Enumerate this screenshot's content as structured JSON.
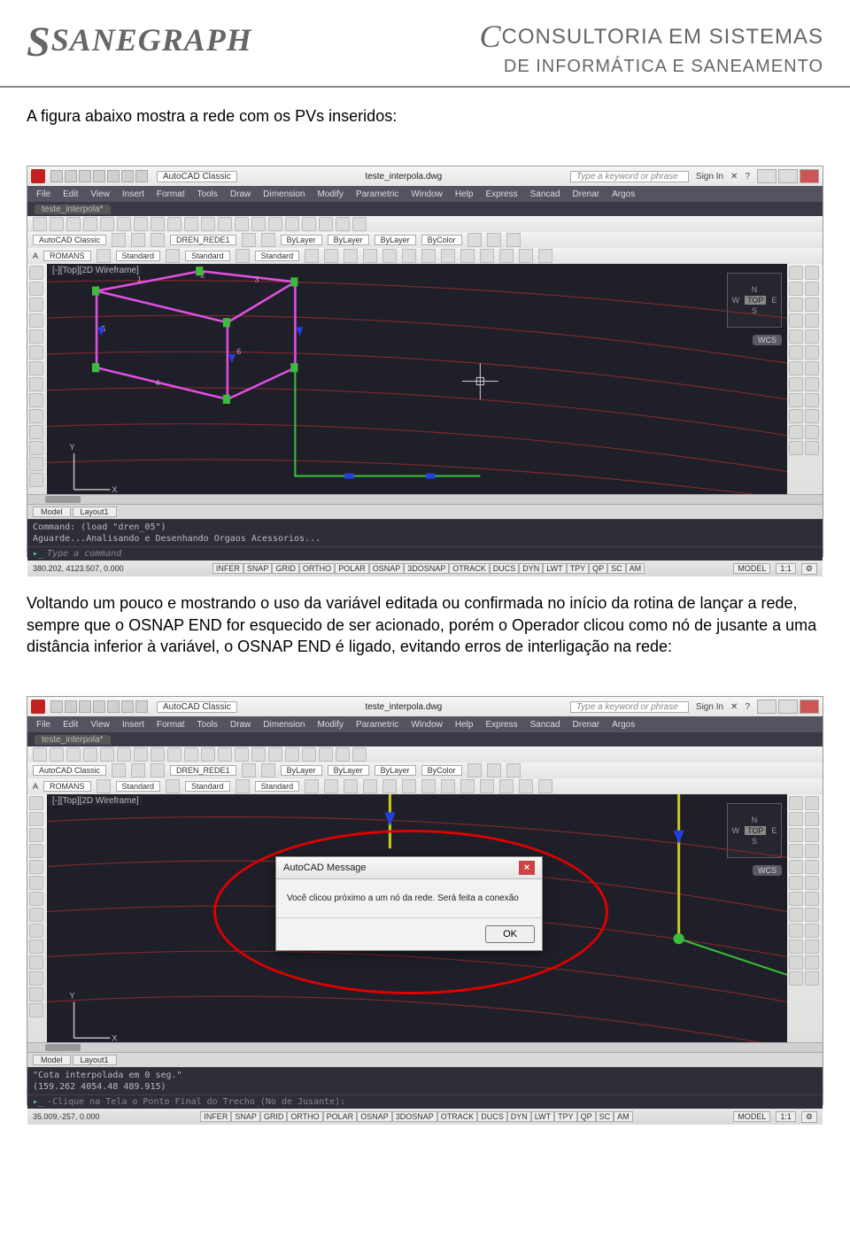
{
  "header": {
    "logo_left": "SANEGRAPH",
    "logo_right_l1": "CONSULTORIA EM SISTEMAS",
    "logo_right_l2": "DE INFORMÁTICA E SANEAMENTO"
  },
  "para1": "A figura abaixo mostra a rede com os PVs inseridos:",
  "para2": "Voltando um pouco e mostrando o uso da variável editada ou confirmada no início da rotina de lançar a rede, sempre que o OSNAP END for esquecido de ser acionado, porém o Operador clicou como nó de jusante a uma distância inferior à variável, o OSNAP END é ligado, evitando erros de interligação na rede:",
  "autocad": {
    "workspace": "AutoCAD Classic",
    "file_title": "teste_interpola.dwg",
    "search_placeholder": "Type a keyword or phrase",
    "signin": "Sign In",
    "menus": [
      "File",
      "Edit",
      "View",
      "Insert",
      "Format",
      "Tools",
      "Draw",
      "Dimension",
      "Modify",
      "Parametric",
      "Window",
      "Help",
      "Express",
      "Sancad",
      "Drenar",
      "Argos"
    ],
    "tab": "teste_interpola*",
    "prop_workspace": "AutoCAD Classic",
    "layer": "DREN_REDE1",
    "bylayer": "ByLayer",
    "bycolor": "ByColor",
    "textstyle": "ROMANS",
    "standard": "Standard",
    "viewport_label": "[-][Top][2D Wireframe]",
    "compass": {
      "n": "N",
      "w": "W",
      "e": "E",
      "s": "S",
      "top": "TOP"
    },
    "wcs": "WCS",
    "model_tab": "Model",
    "layout_tab": "Layout1",
    "cmd1_line1": "Command: (load \"dren_05\")",
    "cmd1_line2": "Aguarde...Analisando e Desenhando Orgaos Acessorios...",
    "cmd_prompt": "Type a command",
    "coords1": "380.202, 4123.507, 0.000",
    "coords2": "35.009,-257, 0.000",
    "toggles": [
      "INFER",
      "SNAP",
      "GRID",
      "ORTHO",
      "POLAR",
      "OSNAP",
      "3DOSNAP",
      "OTRACK",
      "DUCS",
      "DYN",
      "LWT",
      "TPY",
      "QP",
      "SC",
      "AM"
    ],
    "status_model": "MODEL",
    "status_scale": "1:1",
    "cmd2_line1": "\"Cota interpolada em 0 seg.\"",
    "cmd2_line2": "(159.262 4054.48 489.915)",
    "cmd2_prompt": "-Clique na Tela o Ponto Final do Trecho (No de Jusante):"
  },
  "dialog": {
    "title": "AutoCAD Message",
    "body": "Você clicou próximo a um nó da rede. Será feita a conexão",
    "ok": "OK"
  }
}
